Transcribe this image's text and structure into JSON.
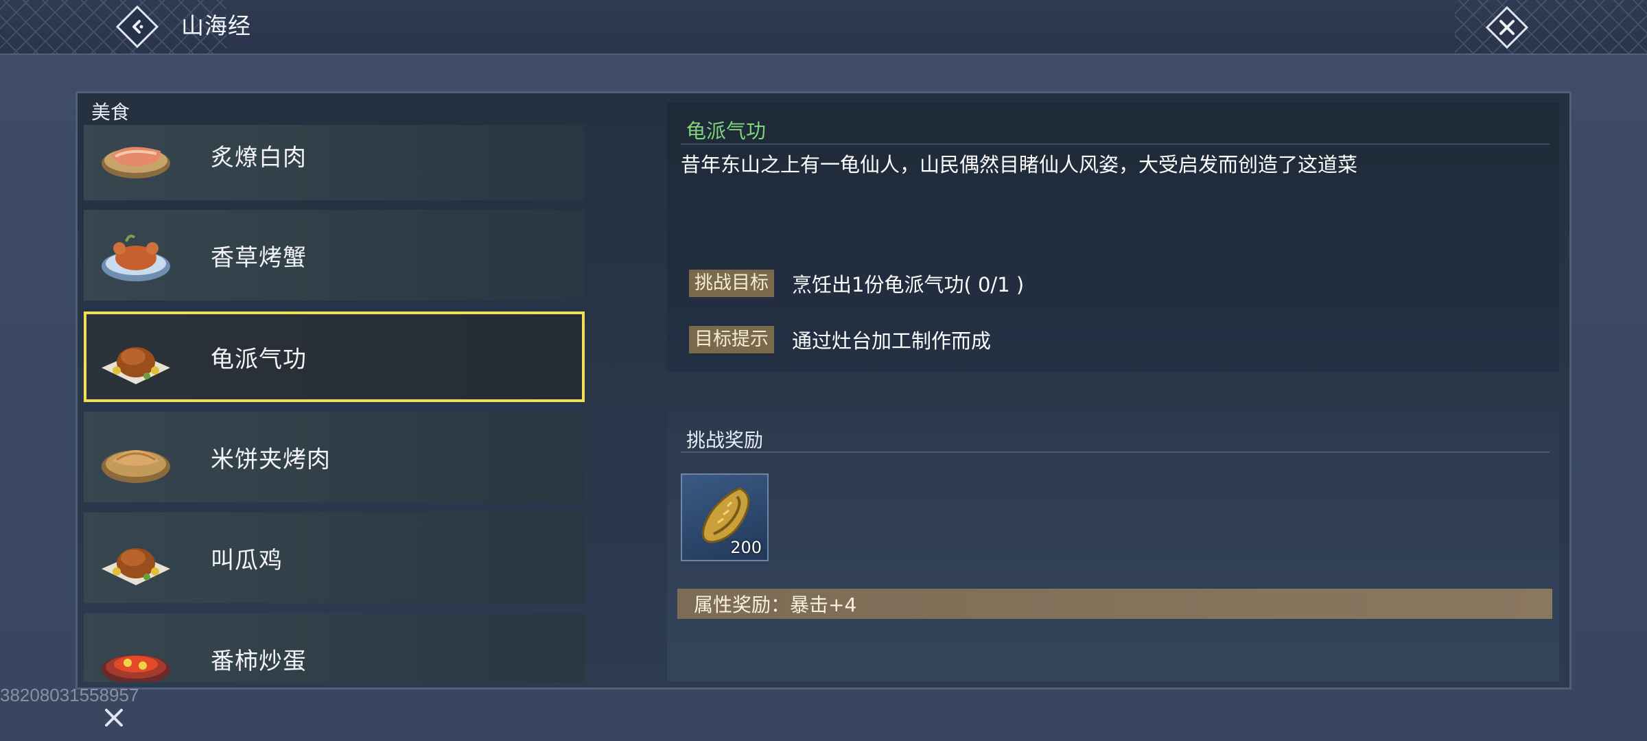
{
  "header": {
    "title": "山海经",
    "back_icon": "back-arrow-icon",
    "close_icon": "close-icon"
  },
  "list": {
    "header": "美食",
    "items": [
      {
        "label": "炙燎白肉",
        "icon": "meat-dish-icon",
        "selected": false
      },
      {
        "label": "香草烤蟹",
        "icon": "crab-dish-icon",
        "selected": false
      },
      {
        "label": "龟派气功",
        "icon": "roast-chicken-icon",
        "selected": true
      },
      {
        "label": "米饼夹烤肉",
        "icon": "pancake-dish-icon",
        "selected": false
      },
      {
        "label": "叫瓜鸡",
        "icon": "roast-chicken-icon",
        "selected": false
      },
      {
        "label": "番柿炒蛋",
        "icon": "tomato-egg-dish-icon",
        "selected": false
      }
    ]
  },
  "detail": {
    "title": "龟派气功",
    "description": "昔年东山之上有一龟仙人，山民偶然目睹仙人风姿，大受启发而创造了这道菜",
    "goal_label": "挑战目标",
    "goal_value": "烹饪出1份龟派气功( 0/1 )",
    "hint_label": "目标提示",
    "hint_value": "通过灶台加工制作而成"
  },
  "reward": {
    "title": "挑战奖励",
    "item_icon": "gold-seed-icon",
    "item_count": "200",
    "attribute_text": "属性奖励：暴击+4"
  },
  "footer": {
    "uid": "38208031558957",
    "close_icon": "close-icon"
  },
  "colors": {
    "title_green": "#7fd37a",
    "selected_border": "#f1df5a",
    "tag_bg": "#7a6a4c"
  }
}
